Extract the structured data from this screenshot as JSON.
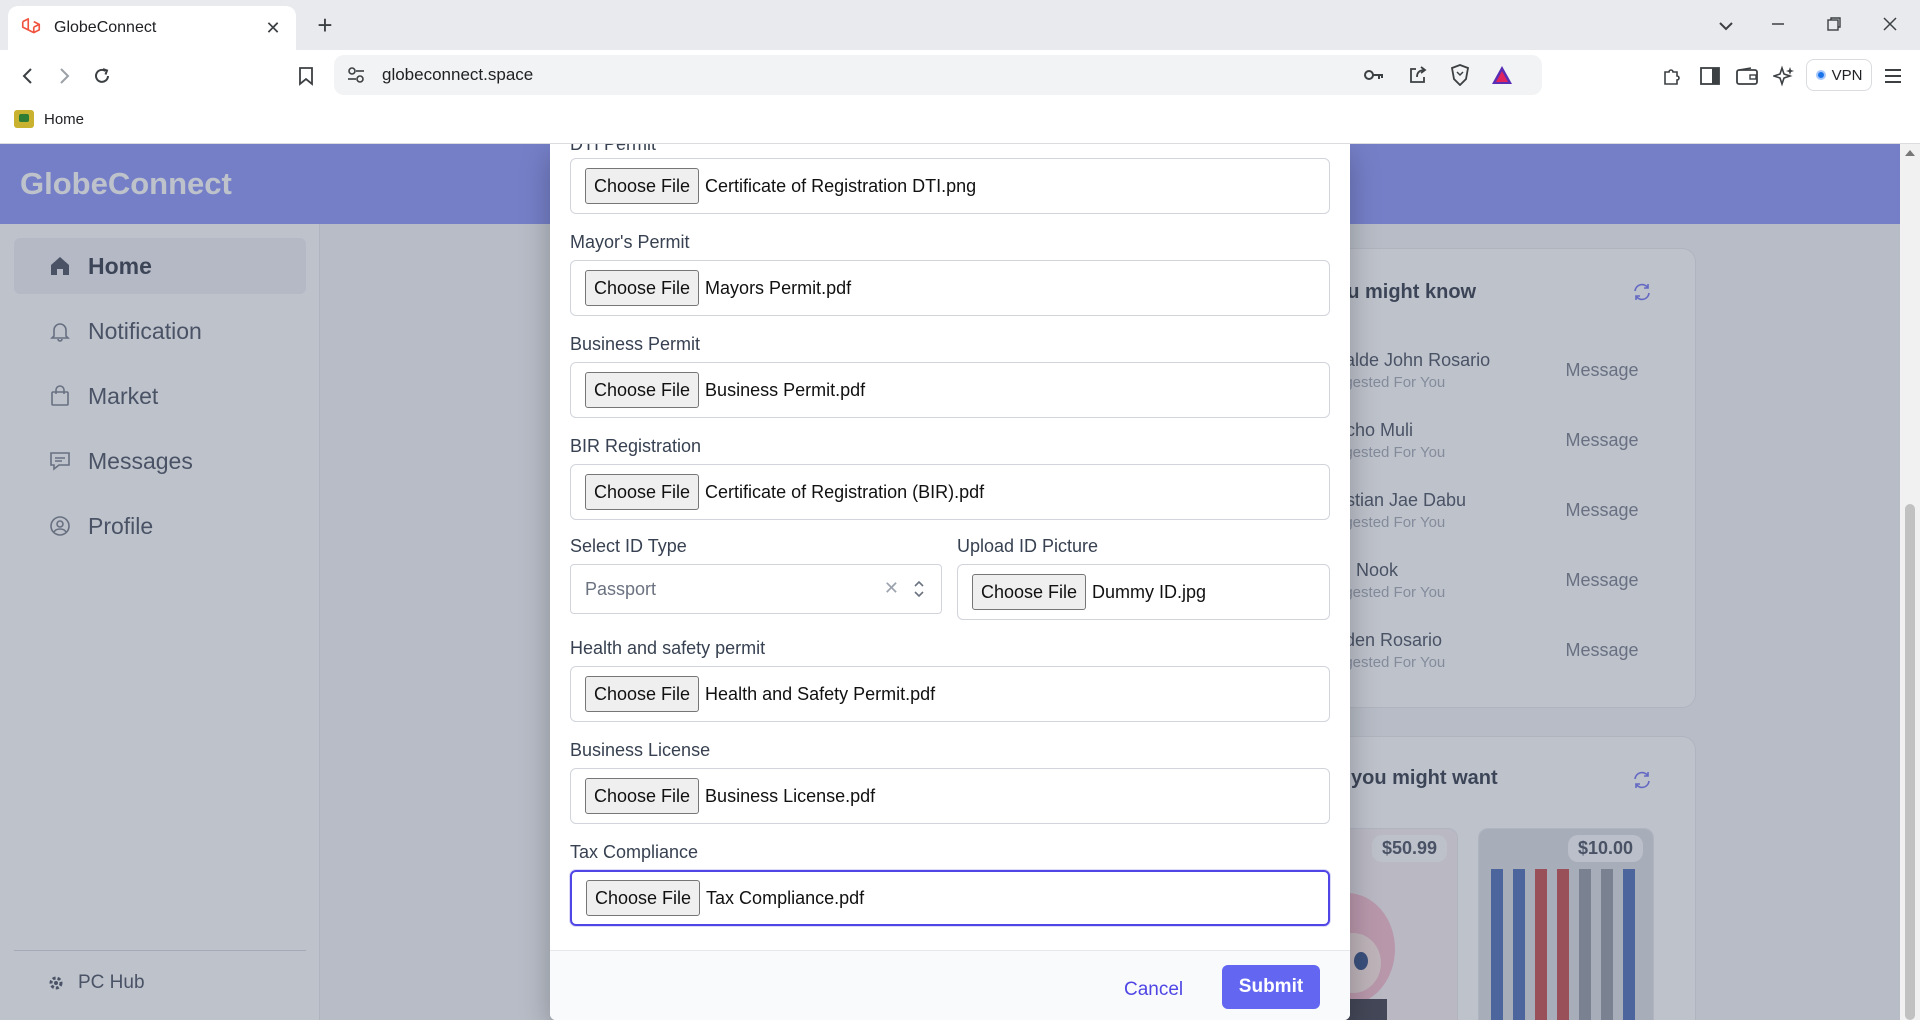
{
  "browser": {
    "tab_title": "GlobeConnect",
    "url": "globeconnect.space",
    "vpn_label": "VPN",
    "bookmark_home": "Home"
  },
  "app": {
    "brand": "GlobeConnect",
    "nav": [
      {
        "label": "Home",
        "icon": "home-icon"
      },
      {
        "label": "Notification",
        "icon": "bell-icon"
      },
      {
        "label": "Market",
        "icon": "bag-icon"
      },
      {
        "label": "Messages",
        "icon": "chat-icon"
      },
      {
        "label": "Profile",
        "icon": "user-circle-icon"
      }
    ],
    "footer_label": "PC Hub"
  },
  "people_card": {
    "title": "ou might know",
    "people": [
      {
        "name": "zalde John Rosario",
        "sub": "ggested For You"
      },
      {
        "name": "richo Muli",
        "sub": "ggested For You"
      },
      {
        "name": "ristian Jae Dabu",
        "sub": "ggested For You"
      },
      {
        "name": "m Nook",
        "sub": "ggested For You"
      },
      {
        "name": "yden Rosario",
        "sub": "ggested For You"
      }
    ],
    "message_label": "Message"
  },
  "products_card": {
    "title": "you might want",
    "products": [
      {
        "price": "$50.99"
      },
      {
        "price": "$10.00"
      }
    ]
  },
  "modal": {
    "partial_label": "DTI Permit",
    "fields": [
      {
        "label": "",
        "file": "Certificate of Registration DTI.png"
      },
      {
        "label": "Mayor's Permit",
        "file": "Mayors Permit.pdf"
      },
      {
        "label": "Business Permit",
        "file": "Business Permit.pdf"
      },
      {
        "label": "BIR Registration",
        "file": "Certificate of Registration (BIR).pdf"
      }
    ],
    "id_type_label": "Select ID Type",
    "id_type_value": "Passport",
    "upload_id_label": "Upload ID Picture",
    "upload_id_file": "Dummy ID.jpg",
    "fields2": [
      {
        "label": "Health and safety permit",
        "file": "Health and Safety Permit.pdf"
      },
      {
        "label": "Business License",
        "file": "Business License.pdf"
      },
      {
        "label": "Tax Compliance",
        "file": "Tax Compliance.pdf"
      }
    ],
    "choose_file_label": "Choose File",
    "cancel_label": "Cancel",
    "submit_label": "Submit"
  }
}
